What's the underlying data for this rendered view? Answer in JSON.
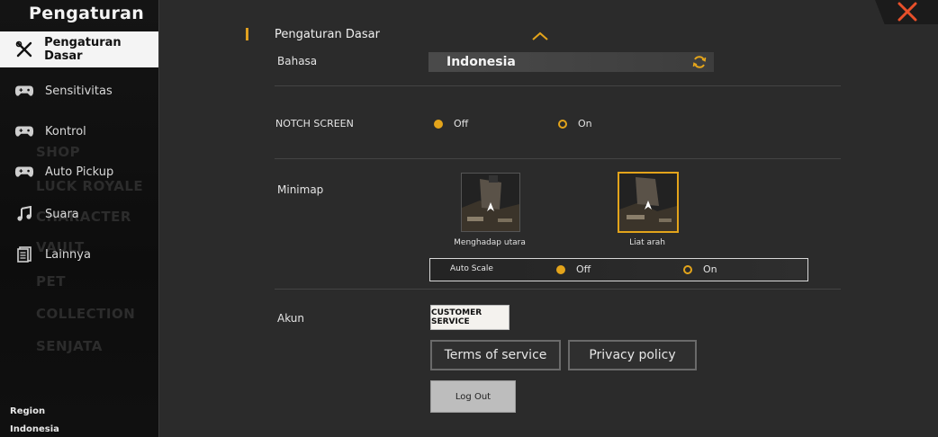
{
  "sidebar": {
    "title": "Pengaturan",
    "items": [
      {
        "label": "Pengaturan Dasar",
        "icon": "wrench-screwdriver-icon",
        "active": true
      },
      {
        "label": "Sensitivitas",
        "icon": "gamepad-icon"
      },
      {
        "label": "Kontrol",
        "icon": "gamepad-icon"
      },
      {
        "label": "Auto Pickup",
        "icon": "gamepad-icon"
      },
      {
        "label": "Suara",
        "icon": "music-note-icon"
      },
      {
        "label": "Lainnya",
        "icon": "document-icon"
      }
    ],
    "background_labels": [
      "SHOP",
      "LUCK ROYALE",
      "CHARACTER",
      "VAULT",
      "PET",
      "COLLECTION",
      "SENJATA"
    ],
    "region_label": "Region",
    "region_value": "Indonesia"
  },
  "main": {
    "section_title": "Pengaturan Dasar",
    "language": {
      "label": "Bahasa",
      "value": "Indonesia"
    },
    "notch": {
      "label": "NOTCH SCREEN",
      "options": [
        "Off",
        "On"
      ],
      "selected": "Off"
    },
    "minimap": {
      "label": "Minimap",
      "options": [
        {
          "caption": "Menghadap utara",
          "selected": false
        },
        {
          "caption": "Liat arah",
          "selected": true
        }
      ],
      "auto_scale": {
        "label": "Auto Scale",
        "options": [
          "Off",
          "On"
        ],
        "selected": "Off"
      }
    },
    "account": {
      "label": "Akun",
      "customer_service": "CUSTOMER SERVICE",
      "terms": "Terms of service",
      "privacy": "Privacy policy",
      "logout": "Log Out"
    }
  },
  "colors": {
    "accent": "#e3a41b",
    "close": "#e8502a"
  }
}
